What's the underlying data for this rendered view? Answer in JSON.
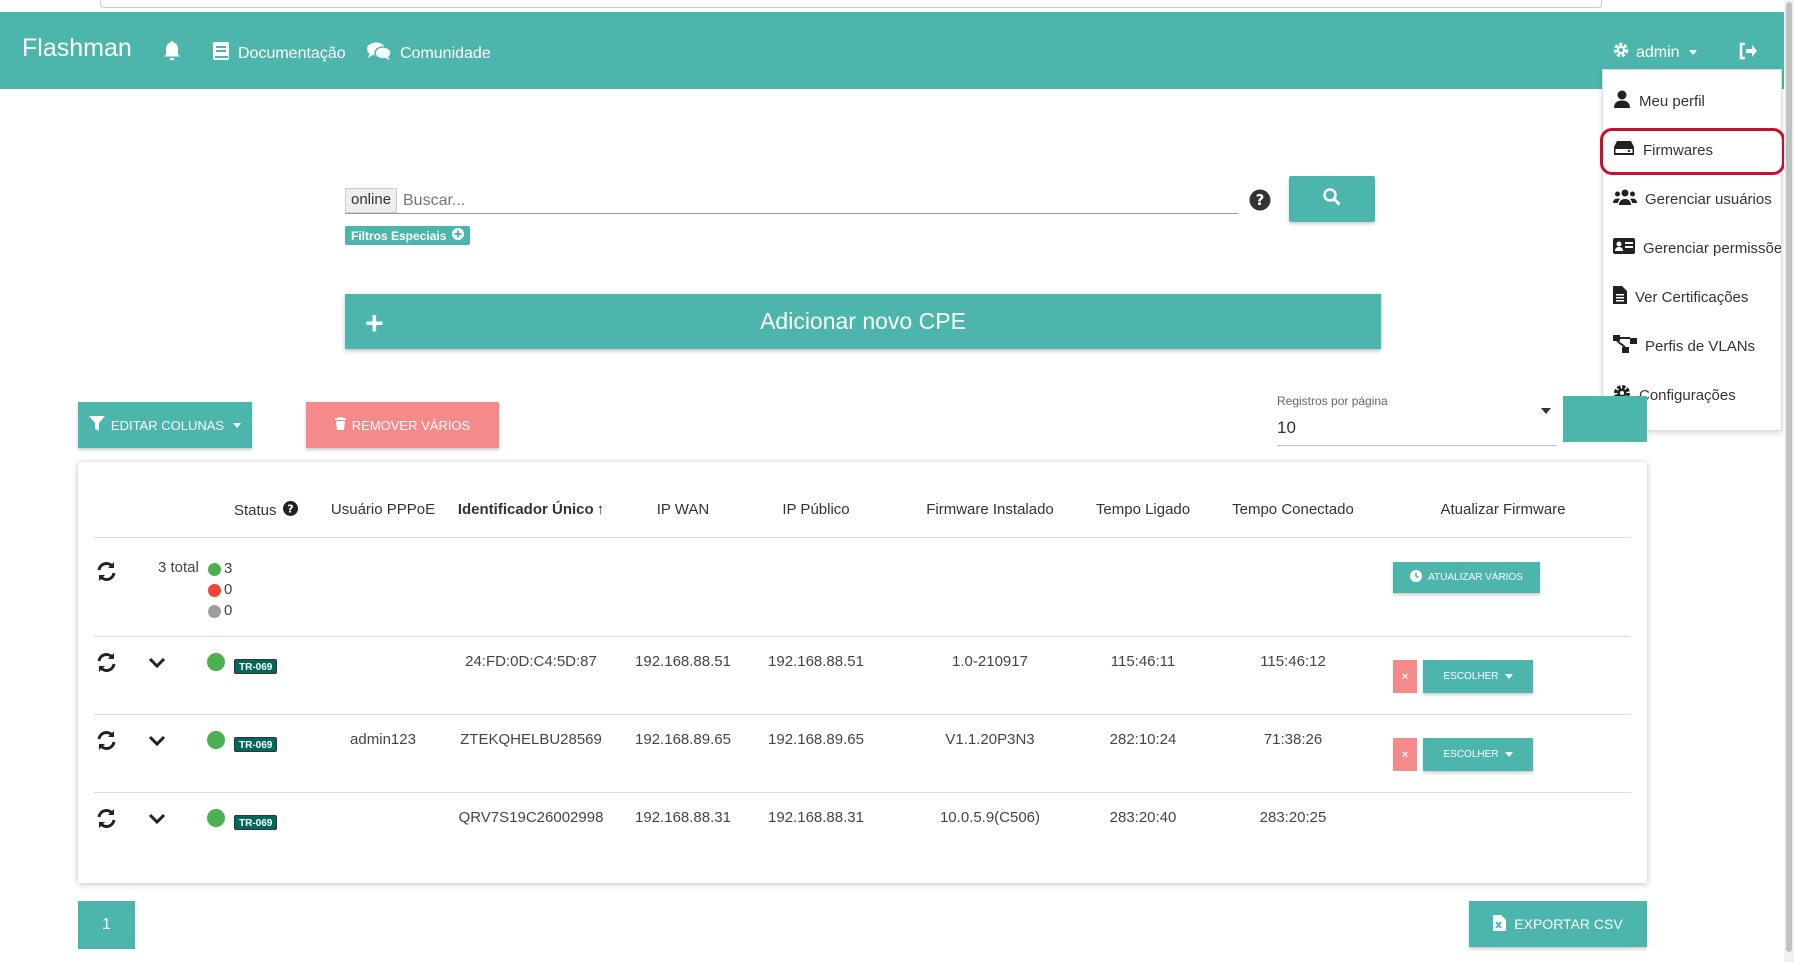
{
  "navbar": {
    "brand": "Flashman",
    "docs": "Documentação",
    "community": "Comunidade",
    "user": "admin"
  },
  "dropdown": {
    "items": [
      "Meu perfil",
      "Firmwares",
      "Gerenciar usuários",
      "Gerenciar permissões",
      "Ver Certificações",
      "Perfis de VLANs",
      "Configurações"
    ]
  },
  "search": {
    "chip": "online",
    "placeholder": "Buscar...",
    "filters": "Filtros Especiais"
  },
  "add_cpe": "Adicionar novo CPE",
  "toolbar": {
    "edit_columns": "EDITAR COLUNAS",
    "remove_many": "REMOVER VÁRIOS",
    "per_page_label": "Registros por página",
    "per_page_value": "10"
  },
  "table": {
    "headers": {
      "status": "Status",
      "pppoe": "Usuário PPPoE",
      "uid": "Identificador Único",
      "ipwan": "IP WAN",
      "ippub": "IP Público",
      "fw": "Firmware Instalado",
      "uptime": "Tempo Ligado",
      "conntime": "Tempo Conectado",
      "update": "Atualizar Firmware"
    },
    "summary": {
      "total": "3 total",
      "online": "3",
      "offline": "0",
      "unknown": "0",
      "update_many": "ATUALIZAR VÁRIOS"
    },
    "rows": [
      {
        "badge": "TR-069",
        "pppoe": "",
        "uid": "24:FD:0D:C4:5D:87",
        "ipwan": "192.168.88.51",
        "ippub": "192.168.88.51",
        "fw": "1.0-210917",
        "uptime": "115:46:11",
        "conntime": "115:46:12",
        "choose": "ESCOLHER",
        "x": "×"
      },
      {
        "badge": "TR-069",
        "pppoe": "admin123",
        "uid": "ZTEKQHELBU28569",
        "ipwan": "192.168.89.65",
        "ippub": "192.168.89.65",
        "fw": "V1.1.20P3N3",
        "uptime": "282:10:24",
        "conntime": "71:38:26",
        "choose": "ESCOLHER",
        "x": "×"
      },
      {
        "badge": "TR-069",
        "pppoe": "",
        "uid": "QRV7S19C26002998",
        "ipwan": "192.168.88.31",
        "ippub": "192.168.88.31",
        "fw": "10.0.5.9(C506)",
        "uptime": "283:20:40",
        "conntime": "283:20:25"
      }
    ]
  },
  "pagination": {
    "page": "1"
  },
  "export": "EXPORTAR CSV",
  "colors": {
    "primary": "#4db6ac",
    "danger": "#f48a8a",
    "online": "#4caf50",
    "offline": "#f44336",
    "unknown": "#9e9e9e",
    "highlight": "#c8102e"
  }
}
